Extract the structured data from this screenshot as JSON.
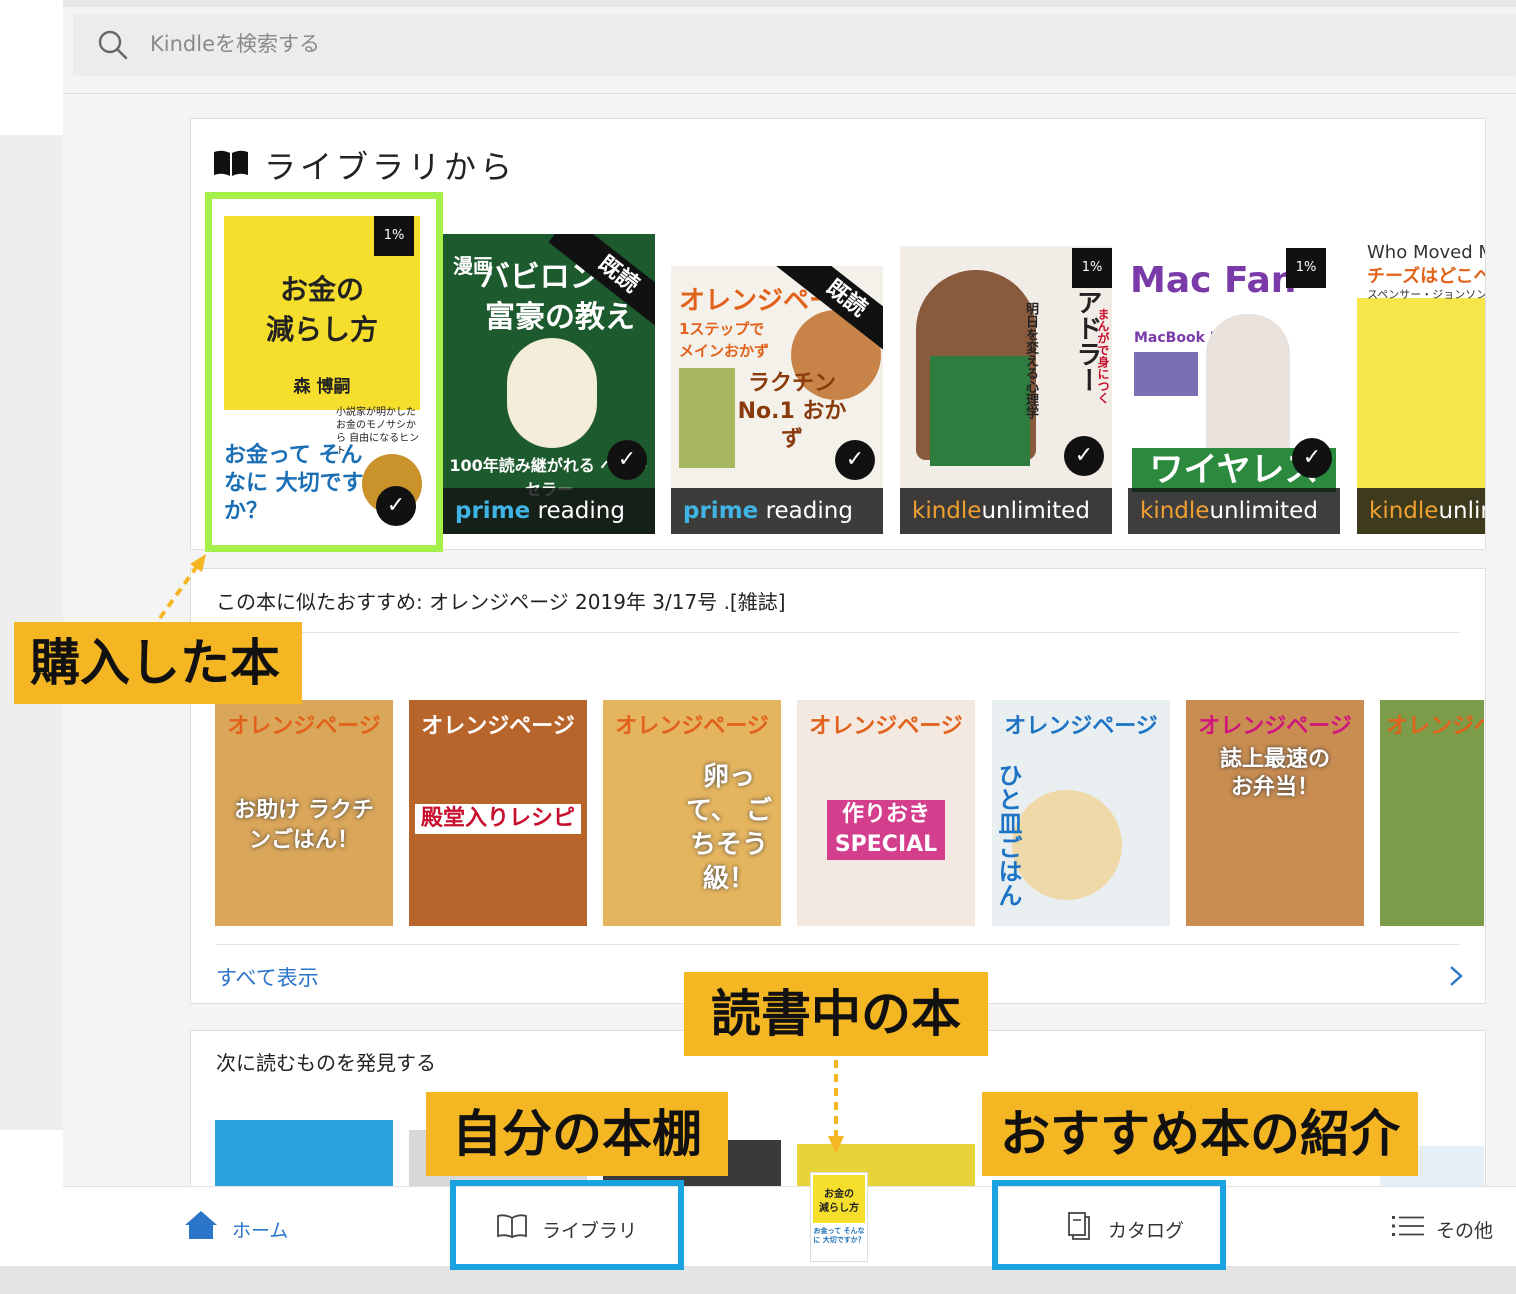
{
  "search": {
    "placeholder": "Kindleを検索する"
  },
  "library_section": {
    "title": "ライブラリから",
    "books": [
      {
        "lines": [
          "お金の",
          "減らし方",
          "森 博嗣"
        ],
        "subtitle": "小説家が明かした お金のモノサシから 自由になるヒント",
        "tagline": "お金って そんなに 大切ですか？",
        "badge": "1%",
        "bg": "#f6df2c"
      },
      {
        "title_top": "漫画",
        "title_main": "バビロン 大富豪の教え",
        "ribbon": "既読",
        "bottom_text": "100年読み継がれる ベストセラー",
        "banner_a": "prime",
        "banner_b": " reading",
        "bg": "#1d5a2e"
      },
      {
        "title_main": "オレンジページ",
        "sub1": "1ステップで メインおかず",
        "sub2": "ラクチン No.1 おかず",
        "ribbon": "既読",
        "banner_a": "prime",
        "banner_b": " reading",
        "bg": "#f3f1ea"
      },
      {
        "title_main": "アドラー",
        "sub1": "まんがで身につく",
        "sub2": "明日を変える心理学",
        "badge": "1%",
        "banner_a": "kindle",
        "banner_b": "unlimited",
        "bg": "#f2ece6"
      },
      {
        "title_main": "Mac Fan",
        "sub1": "MacBook Pro",
        "sub2": "ワイヤレス",
        "badge": "1%",
        "banner_a": "kindle",
        "banner_b": "unlimited",
        "bg": "#ffffff"
      },
      {
        "title_main": "Who Moved M",
        "sub1": "チーズはどこへ",
        "sub2": "スペンサー・ジョンソン",
        "banner_a": "kindle",
        "banner_b": "unlimit",
        "bg": "#f7e64a"
      }
    ]
  },
  "recommend_section": {
    "title": "この本に似たおすすめ: オレンジページ 2019年 3/17号 .[雑誌]",
    "show_all": "すべて表示",
    "books": [
      {
        "title": "オレンジページ",
        "headline": "お助け ラクチンごはん！",
        "bg": "#d9a65a"
      },
      {
        "title": "オレンジページ",
        "headline": "殿堂入りレシピ",
        "bg": "#b8652c"
      },
      {
        "title": "オレンジページ",
        "headline": "卵って、 ごちそう級！",
        "bg": "#e4b45e"
      },
      {
        "title": "オレンジページ",
        "headline": "作りおき SPECIAL",
        "bg": "#f3e9e0"
      },
      {
        "title": "オレンジページ",
        "headline": "ひと皿ごはん",
        "bg": "#e9eef0"
      },
      {
        "title": "オレンジページ",
        "headline": "誌上最速の お弁当！",
        "bg": "#c98d52"
      },
      {
        "title": "オレンジページ",
        "headline": "",
        "bg": "#7d9c4a"
      }
    ]
  },
  "discover_section": {
    "title": "次に読むものを発見する"
  },
  "bottom_nav": {
    "home": "ホーム",
    "library": "ライブラリ",
    "catalog": "カタログ",
    "more": "その他",
    "current_book": {
      "line1": "お金の",
      "line2": "減らし方",
      "line3": "お金って そんなに 大切ですか？"
    }
  },
  "callouts": {
    "purchased": "購入した本",
    "reading": "読書中の本",
    "shelf": "自分の本棚",
    "recommend": "おすすめ本の紹介"
  },
  "colors": {
    "accent": "#2a75c8",
    "callout": "#f5b623",
    "highlight_blue": "#1aa3e0",
    "highlight_green": "#a6ef4a",
    "home_blue": "#2a75c8"
  }
}
